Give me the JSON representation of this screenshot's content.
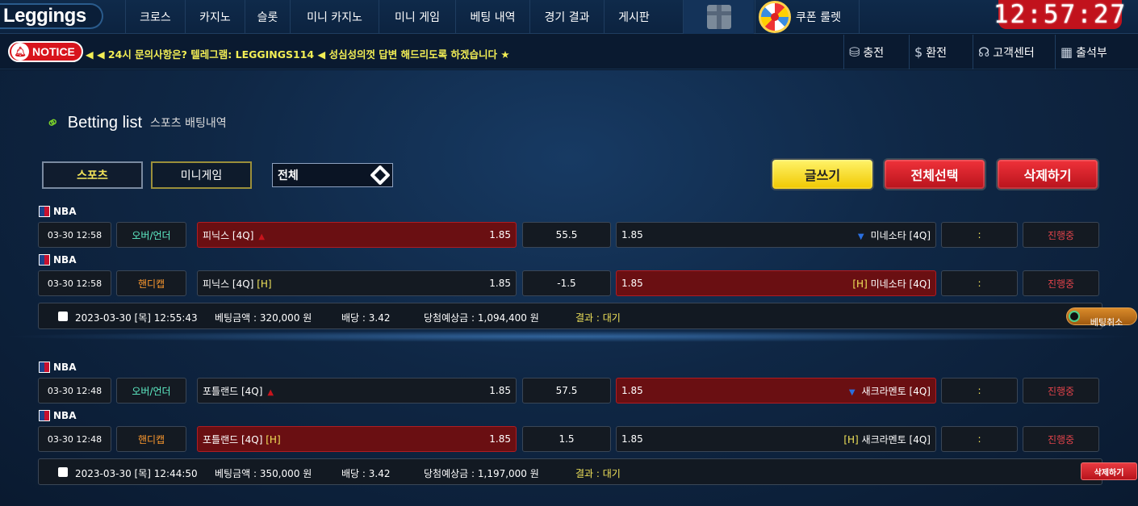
{
  "app": {
    "logo": "Leggings"
  },
  "nav": {
    "items": [
      {
        "label": "크로스",
        "w": 74
      },
      {
        "label": "카지노",
        "w": 74
      },
      {
        "label": "슬롯",
        "w": 56
      },
      {
        "label": "미니 카지노",
        "w": 110
      },
      {
        "label": "미니 게임",
        "w": 95
      },
      {
        "label": "베팅 내역",
        "w": 92
      },
      {
        "label": "경기 결과",
        "w": 92
      },
      {
        "label": "게시판",
        "w": 74
      }
    ],
    "roulette_label": "쿠폰 룰렛",
    "clock": "12:57:27"
  },
  "notice": {
    "badge": "NOTICE",
    "text": "◀ ◀ 24시 문의사항은? 텔레그램: LEGGINGS114 ◀ 성심성의껏 답변 해드리도록 하겠습니다 ★"
  },
  "quick_links": [
    {
      "label": "충전",
      "icon": "coins-icon",
      "glyph": "⛁"
    },
    {
      "label": "환전",
      "icon": "money-hand-icon",
      "glyph": "$"
    },
    {
      "label": "고객센터",
      "icon": "headset-icon",
      "glyph": "☊"
    },
    {
      "label": "출석부",
      "icon": "calendar-icon",
      "glyph": "▦"
    }
  ],
  "page": {
    "title": "Betting list",
    "subtitle": "스포츠 배팅내역"
  },
  "filters": {
    "tab_sports": "스포츠",
    "tab_mini": "미니게임",
    "select_value": "전체"
  },
  "actions": {
    "write": "글쓰기",
    "select_all": "전체선택",
    "delete": "삭제하기"
  },
  "bets": [
    {
      "rows": [
        {
          "league": "NBA",
          "time": "03-30 12:58",
          "type": "오버/언더",
          "type_class": "green",
          "home": "피닉스 [4Q]",
          "home_odds": "1.85",
          "home_sel": true,
          "home_mark": "▲",
          "home_tag": "",
          "line": "55.5",
          "away": "미네소타 [4Q]",
          "away_odds": "1.85",
          "away_sel": false,
          "away_mark": "▼",
          "away_tag": "",
          "score": ":",
          "status": "진행중"
        },
        {
          "league": "NBA",
          "time": "03-30 12:58",
          "type": "핸디캡",
          "type_class": "orange",
          "home": "피닉스 [4Q]",
          "home_odds": "1.85",
          "home_sel": false,
          "home_mark": "",
          "home_tag": "[H]",
          "line": "-1.5",
          "away": "미네소타 [4Q]",
          "away_odds": "1.85",
          "away_sel": true,
          "away_mark": "",
          "away_tag": "[H]",
          "score": ":",
          "status": "진행중"
        }
      ],
      "summary": {
        "date": "2023-03-30 [목] 12:55:43",
        "amount": "베팅금액 : 320,000 원",
        "odds": "배당 : 3.42",
        "expected": "당첨예상금 : 1,094,400 원",
        "result": "결과 : 대기",
        "button": "베팅취소",
        "button_type": "cancel"
      }
    },
    {
      "rows": [
        {
          "league": "NBA",
          "time": "03-30 12:48",
          "type": "오버/언더",
          "type_class": "green",
          "home": "포틀랜드 [4Q]",
          "home_odds": "1.85",
          "home_sel": false,
          "home_mark": "▲",
          "home_tag": "",
          "line": "57.5",
          "away": "새크라멘토 [4Q]",
          "away_odds": "1.85",
          "away_sel": true,
          "away_mark": "▼",
          "away_tag": "",
          "score": ":",
          "status": "진행중"
        },
        {
          "league": "NBA",
          "time": "03-30 12:48",
          "type": "핸디캡",
          "type_class": "orange",
          "home": "포틀랜드 [4Q]",
          "home_odds": "1.85",
          "home_sel": true,
          "home_mark": "",
          "home_tag": "[H]",
          "line": "1.5",
          "away": "새크라멘토 [4Q]",
          "away_odds": "1.85",
          "away_sel": false,
          "away_mark": "",
          "away_tag": "[H]",
          "score": ":",
          "status": "진행중"
        }
      ],
      "summary": {
        "date": "2023-03-30 [목] 12:44:50",
        "amount": "베팅금액 : 350,000 원",
        "odds": "배당 : 3.42",
        "expected": "당첨예상금 : 1,197,000 원",
        "result": "결과 : 대기",
        "button": "삭제하기",
        "button_type": "delete"
      }
    }
  ]
}
